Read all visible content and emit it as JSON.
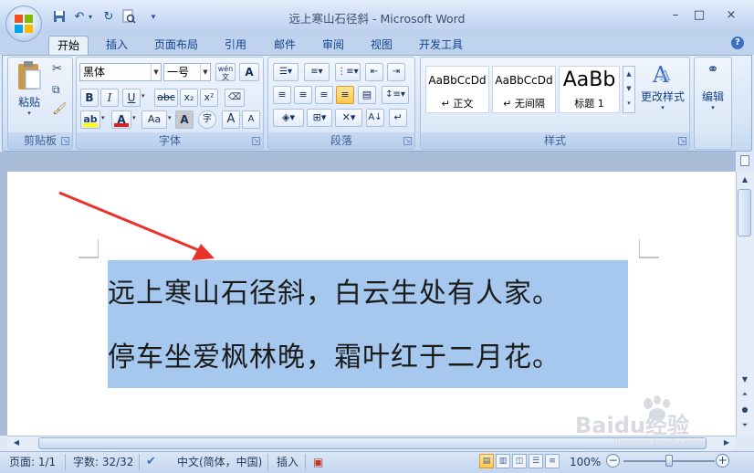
{
  "window": {
    "title": "远上寒山石径斜 - Microsoft Word",
    "controls": {
      "minimize": "–",
      "maximize": "□",
      "close": "×"
    }
  },
  "quick_access": {
    "save_icon": "save-icon",
    "undo_icon": "undo-icon",
    "redo_icon": "repeat-icon",
    "preview_icon": "print-preview-icon",
    "customize_icon": "dropdown-icon"
  },
  "tabs": [
    {
      "label": "开始",
      "active": true
    },
    {
      "label": "插入"
    },
    {
      "label": "页面布局"
    },
    {
      "label": "引用"
    },
    {
      "label": "邮件"
    },
    {
      "label": "审阅"
    },
    {
      "label": "视图"
    },
    {
      "label": "开发工具"
    }
  ],
  "ribbon": {
    "clipboard": {
      "label": "剪贴板",
      "paste_label": "粘贴"
    },
    "font": {
      "label": "字体",
      "font_name": "黑体",
      "font_size": "一号",
      "phonetic_guide": "wén",
      "bold": "B",
      "italic": "I",
      "underline": "U",
      "strikethrough": "abc",
      "subscript": "x₂",
      "superscript": "x²",
      "change_case": "Aa",
      "grow_font": "A",
      "shrink_font": "A",
      "char_shading": "A",
      "enclose_char": "字",
      "highlight_color": "#ffff00",
      "font_color": "#e02020"
    },
    "paragraph": {
      "label": "段落"
    },
    "styles": {
      "label": "样式",
      "items": [
        {
          "sample": "AaBbCcDd",
          "name": "↵ 正文"
        },
        {
          "sample": "AaBbCcDd",
          "name": "↵ 无间隔"
        },
        {
          "sample": "AaBb",
          "name": "标题 1"
        }
      ],
      "change_styles_label": "更改样式"
    },
    "editing": {
      "label": "编辑"
    }
  },
  "document": {
    "lines": [
      "远上寒山石径斜，白云生处有人家。",
      "停车坐爱枫林晚，霜叶红于二月花。"
    ],
    "selection_color": "#a6c8ee",
    "annotation_arrow_color": "#e8322a"
  },
  "status_bar": {
    "page": "页面: 1/1",
    "word_count": "字数: 32/32",
    "language": "中文(简体，中国)",
    "mode": "插入",
    "zoom": "100%",
    "zoom_level": 1.0
  },
  "watermark": {
    "text": "Baidu经验",
    "url_text": "jingyan.baidu.com"
  }
}
